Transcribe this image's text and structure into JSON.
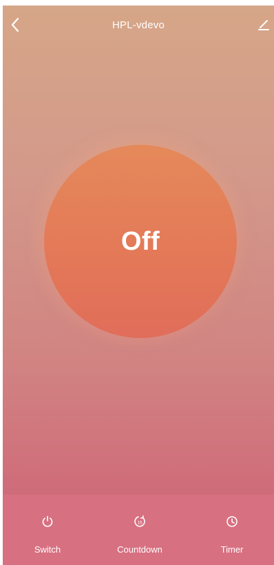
{
  "header": {
    "title": "HPL-vdevo",
    "back_icon": "chevron-left-icon",
    "edit_icon": "pencil-icon"
  },
  "device": {
    "state_label": "Off"
  },
  "tabs": [
    {
      "label": "Switch",
      "icon": "power-icon"
    },
    {
      "label": "Countdown",
      "icon": "countdown-icon"
    },
    {
      "label": "Timer",
      "icon": "clock-icon"
    }
  ],
  "colors": {
    "background_top": "#d6a688",
    "background_bottom": "#cf6a79",
    "power_button": "#e37558",
    "text": "#ffffff"
  }
}
